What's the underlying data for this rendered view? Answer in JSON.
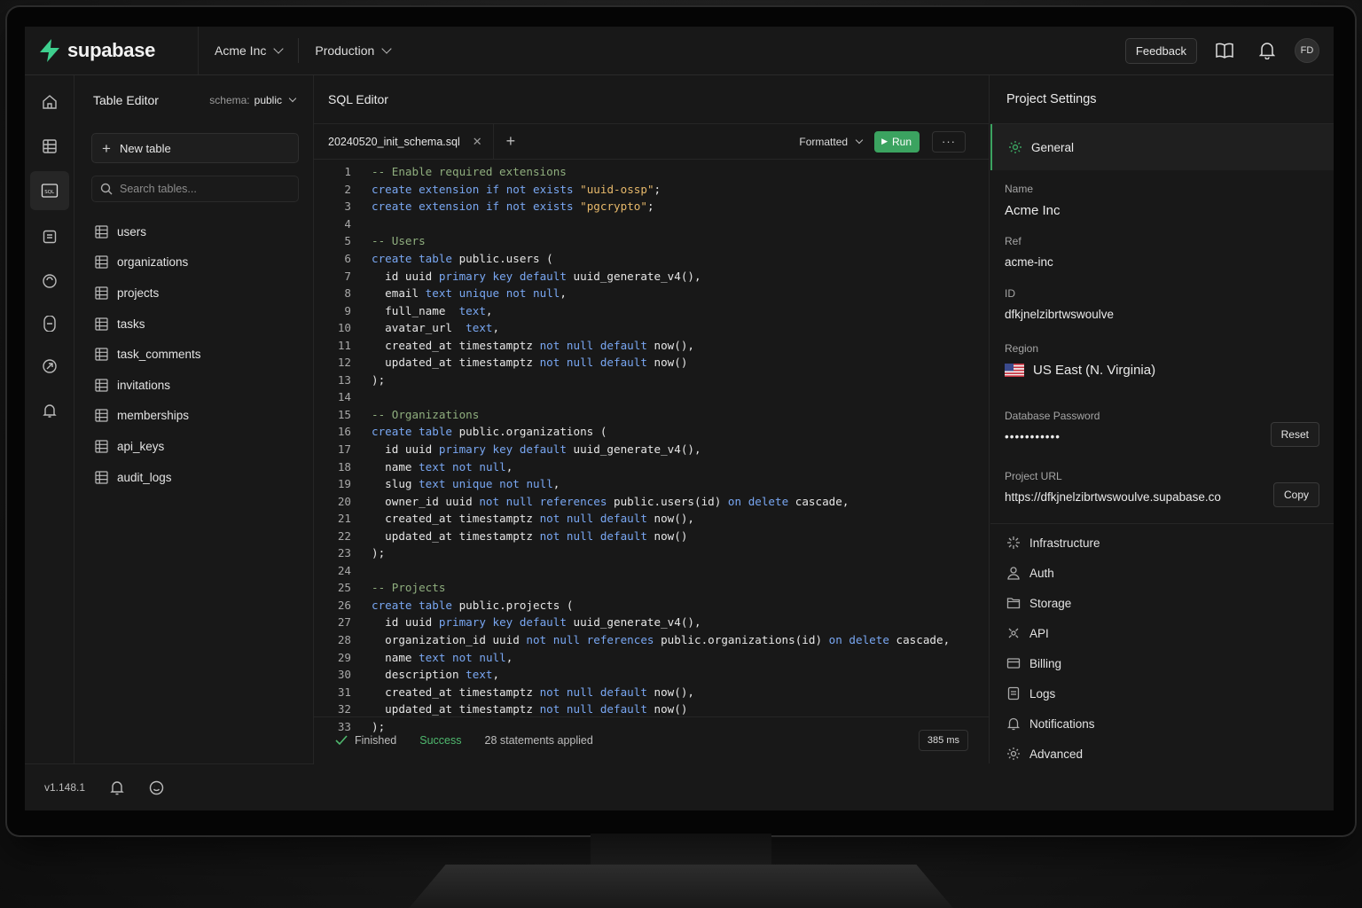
{
  "app": {
    "name": "supabase"
  },
  "colors": {
    "accent": "#3ba360",
    "keyword": "#79a7f2",
    "string": "#e6b86a",
    "comment": "#8fae7e"
  },
  "header": {
    "org": "Acme Inc",
    "env": "Production",
    "feedback": "Feedback",
    "avatar": "FD",
    "icons": [
      "docs-book-icon",
      "bell-icon"
    ]
  },
  "rail": {
    "items": [
      "home-icon",
      "table-editor-icon",
      "sql-editor-icon",
      "database-icon",
      "auth-icon",
      "storage-icon",
      "edge-functions-icon",
      "notifications-icon"
    ],
    "active": 2
  },
  "table_editor": {
    "title": "Table Editor",
    "schema_label": "schema:",
    "schema_value": "public",
    "new_table": "New table",
    "search_placeholder": "Search tables...",
    "tables": [
      "users",
      "organizations",
      "projects",
      "tasks",
      "task_comments",
      "invitations",
      "memberships",
      "api_keys",
      "audit_logs"
    ]
  },
  "footer": {
    "version": "v1.148.1"
  },
  "sql_editor": {
    "title": "SQL Editor",
    "tab": "20240520_init_schema.sql",
    "format": "Formatted",
    "run": "Run",
    "lines": [
      "-- Enable required extensions",
      "create extension if not exists \"uuid-ossp\";",
      "create extension if not exists \"pgcrypto\";",
      "",
      "-- Users",
      "create table public.users (",
      "  id uuid primary key default uuid_generate_v4(),",
      "  email text unique not null,",
      "  full_name  text,",
      "  avatar_url  text,",
      "  created_at timestamptz not null default now(),",
      "  updated_at timestamptz not null default now()",
      ");",
      "",
      "-- Organizations",
      "create table public.organizations (",
      "  id uuid primary key default uuid_generate_v4(),",
      "  name text not null,",
      "  slug text unique not null,",
      "  owner_id uuid not null references public.users(id) on delete cascade,",
      "  created_at timestamptz not null default now(),",
      "  updated_at timestamptz not null default now()",
      ");",
      "",
      "-- Projects",
      "create table public.projects (",
      "  id uuid primary key default uuid_generate_v4(),",
      "  organization_id uuid not null references public.organizations(id) on delete cascade,",
      "  name text not null,",
      "  description text,",
      "  created_at timestamptz not null default now(),",
      "  updated_at timestamptz not null default now()",
      ");"
    ],
    "status": {
      "finished": "Finished",
      "result": "Success",
      "applied": "28 statements applied",
      "duration": "385 ms"
    }
  },
  "settings": {
    "title": "Project Settings",
    "general": "General",
    "fields": {
      "name_label": "Name",
      "name": "Acme Inc",
      "ref_label": "Ref",
      "ref": "acme-inc",
      "id_label": "ID",
      "id": "dfkjnelzibrtwswoulve",
      "region_label": "Region",
      "region": "US East (N. Virginia)",
      "password_label": "Database Password",
      "password": "•••••••••••",
      "reset": "Reset",
      "url_label": "Project URL",
      "url": "https://dfkjnelzibrtwswoulve.supabase.co",
      "copy": "Copy"
    },
    "menu": [
      {
        "label": "Infrastructure",
        "icon": "infrastructure-icon"
      },
      {
        "label": "Auth",
        "icon": "auth-icon"
      },
      {
        "label": "Storage",
        "icon": "storage-folder-icon"
      },
      {
        "label": "API",
        "icon": "api-icon"
      },
      {
        "label": "Billing",
        "icon": "billing-card-icon"
      },
      {
        "label": "Logs",
        "icon": "logs-icon"
      },
      {
        "label": "Notifications",
        "icon": "bell-icon"
      },
      {
        "label": "Advanced",
        "icon": "advanced-gear-icon"
      }
    ]
  }
}
